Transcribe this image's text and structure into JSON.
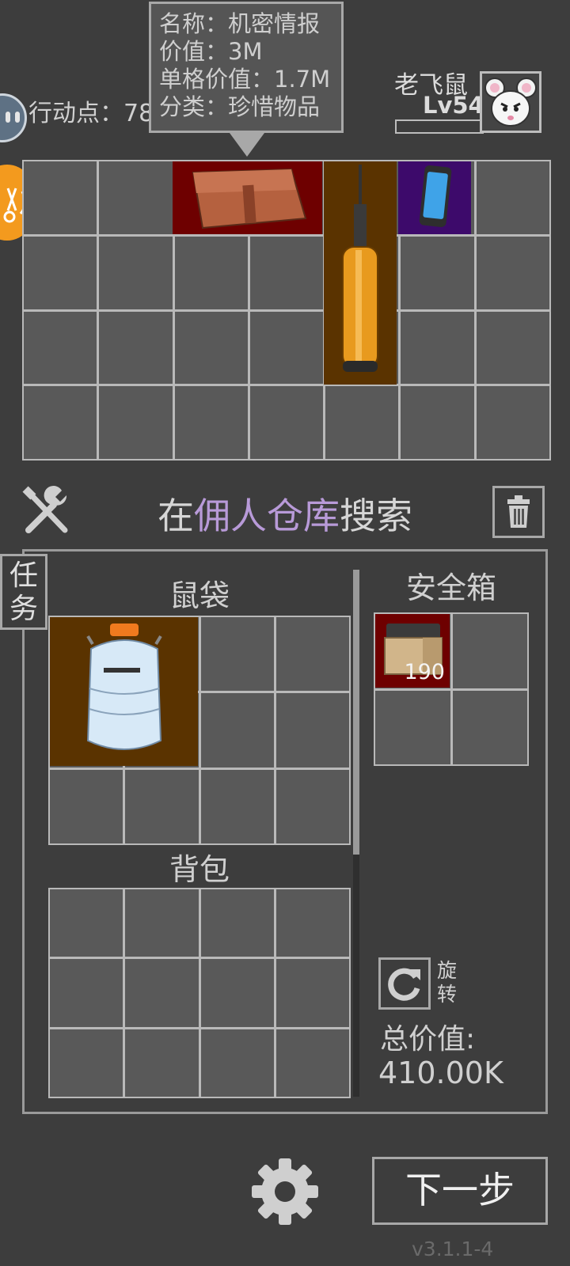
{
  "tooltip": {
    "name_line": "名称：机密情报",
    "value_line": "价值：3M",
    "unit_value_line": "单格价值：1.7M",
    "category_line": "分类：珍惜物品"
  },
  "action_points": {
    "label": "行动点：78"
  },
  "player": {
    "name": "老飞鼠",
    "level": "Lv54",
    "avatar_icon": "white-mouse-avatar-icon"
  },
  "search": {
    "prefix": "在",
    "location": "佣人仓库",
    "suffix": "搜索",
    "location_color": "#b89ad8"
  },
  "task_button": {
    "label": "任务"
  },
  "pouch": {
    "title": "鼠袋"
  },
  "backpack": {
    "title": "背包"
  },
  "safe_box": {
    "title": "安全箱",
    "item_count": "190"
  },
  "rotate": {
    "label": "旋转",
    "icon": "rotate-icon"
  },
  "total_value": {
    "label": "总价值:",
    "value": "410.00K"
  },
  "next_button": {
    "label": "下一步"
  },
  "version": "v3.1.1-4",
  "colors": {
    "red_rarity": "#6e0000",
    "orange_rarity": "#5a3300",
    "purple_rarity": "#3d0a6b",
    "orange_accent": "#f39a1e"
  }
}
